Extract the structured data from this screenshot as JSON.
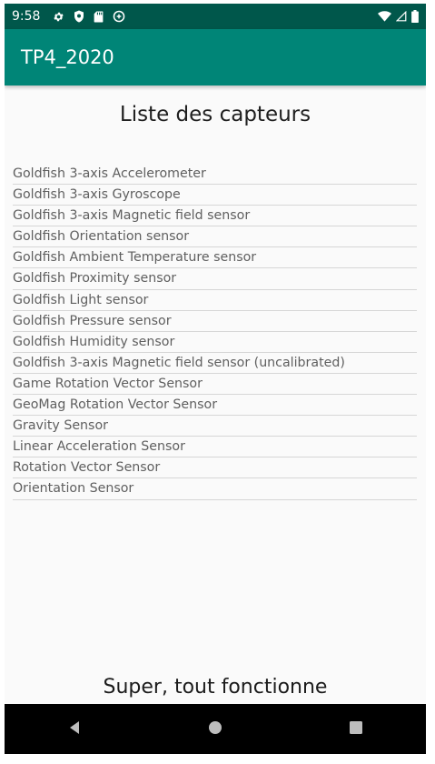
{
  "status_bar": {
    "time": "9:58",
    "left_icons": [
      "settings-icon",
      "shield-icon",
      "sd-card-icon",
      "data-saver-icon"
    ],
    "right_icons": [
      "wifi-icon",
      "signal-icon",
      "battery-icon"
    ]
  },
  "app_bar": {
    "title": "TP4_2020"
  },
  "main": {
    "title": "Liste des capteurs",
    "sensors": [
      "Goldfish 3-axis Accelerometer",
      "Goldfish 3-axis Gyroscope",
      "Goldfish 3-axis Magnetic field sensor",
      "Goldfish Orientation sensor",
      "Goldfish Ambient Temperature sensor",
      "Goldfish Proximity sensor",
      "Goldfish Light sensor",
      "Goldfish Pressure sensor",
      "Goldfish Humidity sensor",
      "Goldfish 3-axis Magnetic field sensor (uncalibrated)",
      "Game Rotation Vector Sensor",
      "GeoMag Rotation Vector Sensor",
      "Gravity Sensor",
      "Linear Acceleration Sensor",
      "Rotation Vector Sensor",
      "Orientation Sensor"
    ],
    "status_message": "Super, tout fonctionne"
  },
  "nav_bar": {
    "buttons": [
      "back-icon",
      "home-icon",
      "recents-icon"
    ]
  },
  "colors": {
    "status_bar": "#00574b",
    "app_bar": "#008577",
    "background": "#fafafa",
    "nav_bar": "#000000"
  }
}
